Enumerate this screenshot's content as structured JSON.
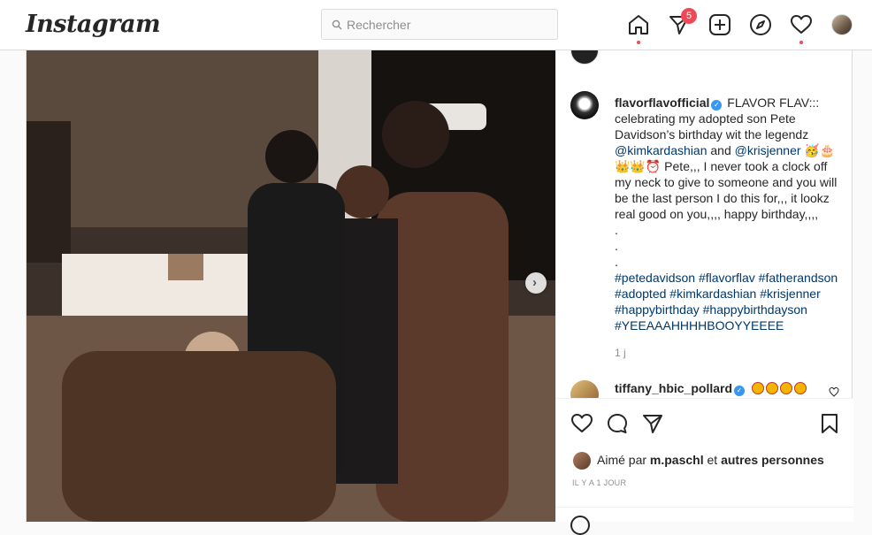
{
  "app": {
    "logo": "Instagram"
  },
  "search": {
    "placeholder": "Rechercher"
  },
  "nav": {
    "direct_badge": "5"
  },
  "caption": {
    "username": "flavorflavofficial",
    "line1": " FLAVOR FLAV::: celebrating my adopted son Pete Davidson’s birthday wit the legendz ",
    "mention1": "@kimkardashian",
    "and": " and ",
    "mention2": "@krisjenner",
    "line2": " Pete,,, I never took a clock off my neck to give to someone and you will be the last person I do this for,,, it lookz real good on you,,,, happy birthday,,,,",
    "dots": ".",
    "hashtags": [
      "#petedavidson",
      "#flavorflav",
      "#fatherandson",
      "#adopted",
      "#kimkardashian",
      "#krisjenner",
      "#happybirthday",
      "#happybirthdayson",
      "#YEEAAAHHHHBOOYYEEEE"
    ],
    "time": "1 j"
  },
  "comment": {
    "username": "tiffany_hbic_pollard"
  },
  "likes": {
    "prefix": "Aimé par ",
    "user": "m.paschl",
    "middle": " et ",
    "others": "autres personnes"
  },
  "date": "IL Y A 1 JOUR",
  "colors": {
    "accent": "#3897f0",
    "badge": "#ed4956",
    "link": "#00376b"
  }
}
